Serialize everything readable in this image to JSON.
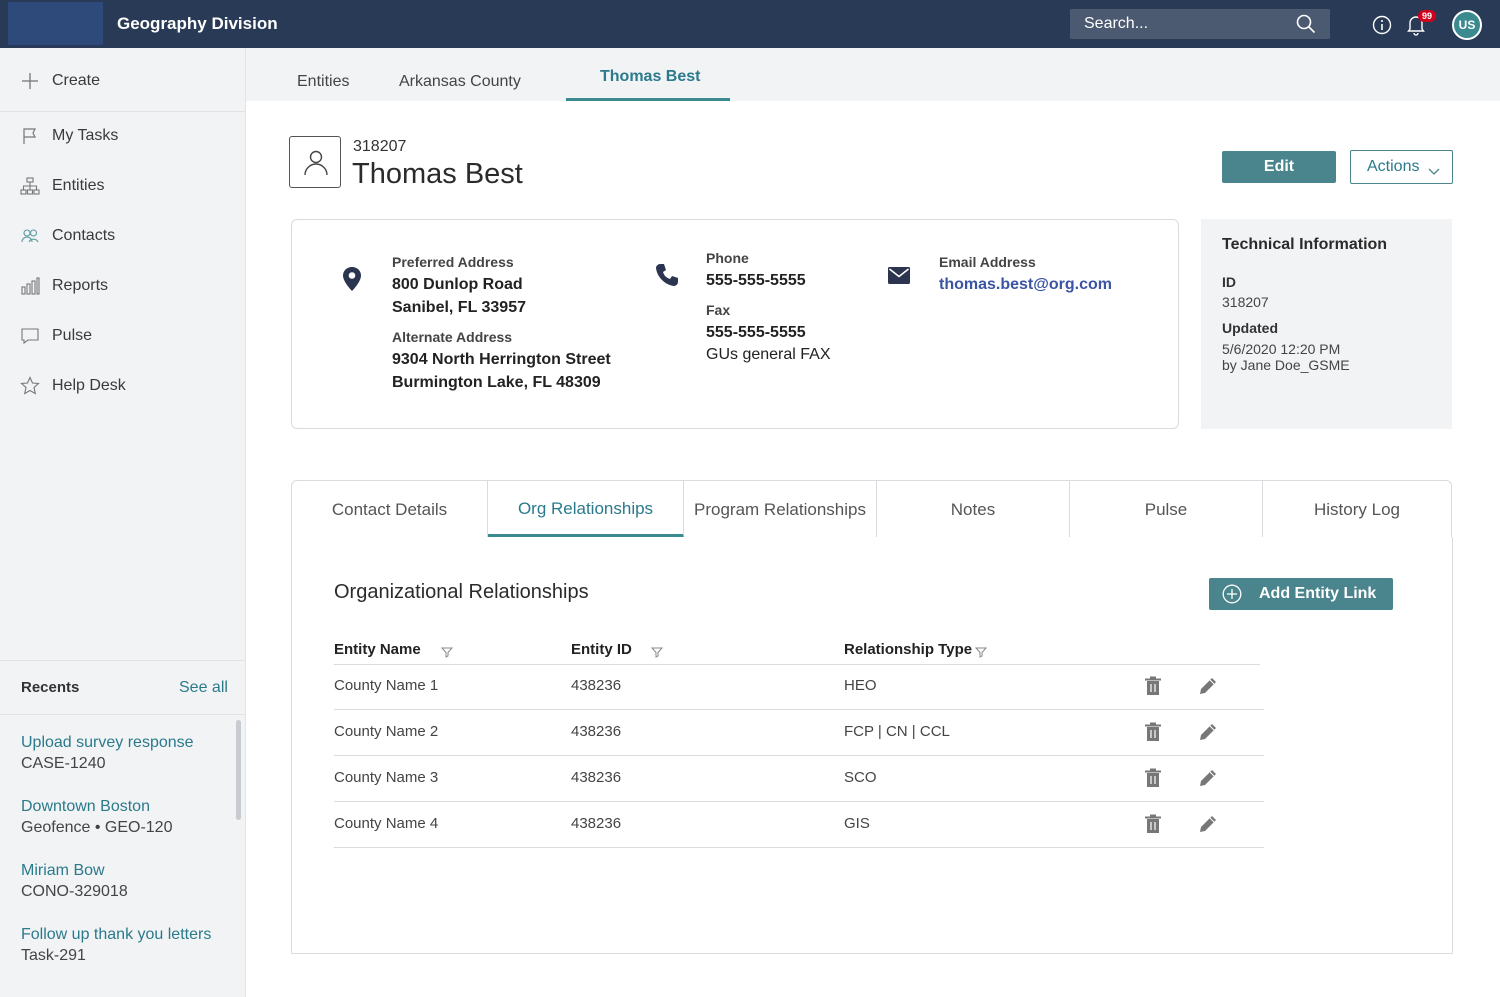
{
  "app": {
    "title": "Geography Division",
    "search_placeholder": "Search...",
    "notification_count": "99",
    "user_initials": "US"
  },
  "sidebar": {
    "items": [
      {
        "label": "Create",
        "icon": "plus-icon"
      },
      {
        "label": "My Tasks",
        "icon": "flag-icon"
      },
      {
        "label": "Entities",
        "icon": "hierarchy-icon"
      },
      {
        "label": "Contacts",
        "icon": "people-icon"
      },
      {
        "label": "Reports",
        "icon": "bar-chart-icon"
      },
      {
        "label": "Pulse",
        "icon": "chat-icon"
      },
      {
        "label": "Help Desk",
        "icon": "star-icon"
      }
    ],
    "recents": {
      "title": "Recents",
      "see_all": "See all",
      "items": [
        {
          "title": "Upload survey response",
          "subtitle": "CASE-1240"
        },
        {
          "title": "Downtown Boston",
          "subtitle": "Geofence • GEO-120"
        },
        {
          "title": "Miriam Bow",
          "subtitle": "CONO-329018"
        },
        {
          "title": "Follow up thank you letters",
          "subtitle": "Task-291"
        }
      ]
    }
  },
  "tabs": [
    {
      "label": "Entities"
    },
    {
      "label": "Arkansas County"
    },
    {
      "label": "Thomas Best",
      "active": true
    }
  ],
  "record": {
    "id": "318207",
    "name": "Thomas Best",
    "edit_label": "Edit",
    "actions_label": "Actions"
  },
  "contact": {
    "preferred_label": "Preferred Address",
    "preferred_line1": "800 Dunlop Road",
    "preferred_line2": "Sanibel, FL 33957",
    "alternate_label": "Alternate Address",
    "alternate_line1": "9304 North Herrington Street",
    "alternate_line2": "Burmington Lake, FL 48309",
    "phone_label": "Phone",
    "phone": "555-555-5555",
    "fax_label": "Fax",
    "fax": "555-555-5555",
    "fax_note": "GUs general FAX",
    "email_label": "Email Address",
    "email": "thomas.best@org.com"
  },
  "technical": {
    "title": "Technical Information",
    "id_label": "ID",
    "id_value": "318207",
    "updated_label": "Updated",
    "updated_value": "5/6/2020 12:20 PM",
    "updated_by": "by Jane Doe_GSME"
  },
  "subtabs": [
    {
      "label": "Contact Details"
    },
    {
      "label": "Org Relationships",
      "active": true
    },
    {
      "label": "Program Relationships"
    },
    {
      "label": "Notes"
    },
    {
      "label": "Pulse"
    },
    {
      "label": "History Log"
    }
  ],
  "org": {
    "title": "Organizational Relationships",
    "add_label": "Add Entity Link",
    "columns": [
      "Entity Name",
      "Entity ID",
      "Relationship Type"
    ],
    "rows": [
      [
        "County Name 1",
        "438236",
        "HEO"
      ],
      [
        "County Name 2",
        "438236",
        "FCP | CN | CCL"
      ],
      [
        "County Name 3",
        "438236",
        "SCO"
      ],
      [
        "County Name 4",
        "438236",
        "GIS"
      ]
    ]
  },
  "colors": {
    "topbar": "#283a55",
    "accent": "#4a848c",
    "link": "#2a7a8c",
    "badge": "#d0021b"
  }
}
